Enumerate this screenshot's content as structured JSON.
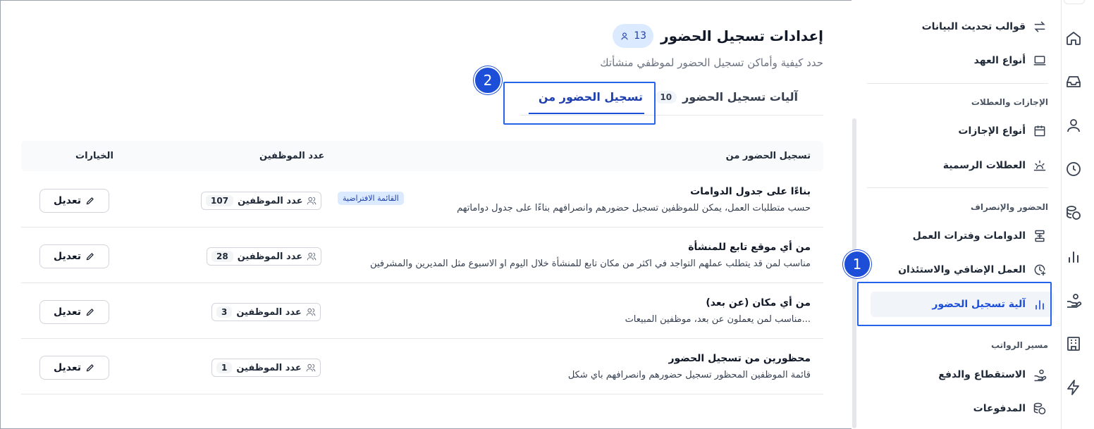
{
  "rail": {
    "icons": [
      "home-icon",
      "inbox-icon",
      "user-icon",
      "clock-icon",
      "coins-icon",
      "bar-chart-icon",
      "hand-money-icon",
      "building-icon",
      "lightning-icon"
    ]
  },
  "sidebar": {
    "items_top": [
      {
        "label": "قوالب تحديث البيانات",
        "icon": "swap-arrows-icon"
      },
      {
        "label": "أنواع العهد",
        "icon": "laptop-icon"
      }
    ],
    "section_leaves": "الإجازات والعطلات",
    "items_leaves": [
      {
        "label": "أنواع الإجازات",
        "icon": "calendar-icon"
      },
      {
        "label": "العطلات الرسمية",
        "icon": "sunset-icon"
      }
    ],
    "section_attendance": "الحضور والإنصراف",
    "items_attendance": [
      {
        "label": "الدوامات وفترات العمل",
        "icon": "shifts-icon"
      },
      {
        "label": "العمل الإضافي والاستئذان",
        "icon": "clock-plus-icon"
      },
      {
        "label": "آلية تسجيل الحضور",
        "icon": "bar-chart-icon"
      }
    ],
    "section_payroll": "مسير الرواتب",
    "items_payroll": [
      {
        "label": "الاستقطاع والدفع",
        "icon": "hand-money-icon"
      },
      {
        "label": "المدفوعات",
        "icon": "coins-icon"
      }
    ]
  },
  "annotations": {
    "one": "1",
    "two": "2"
  },
  "header": {
    "title": "إعدادات تسجيل الحضور",
    "count": "13",
    "subtitle": "حدد كيفية وأماكن تسجيل الحضور لموظفي منشأتك"
  },
  "tabs": {
    "mechanisms_label": "آليات تسجيل الحضور",
    "mechanisms_count": "10",
    "from_label": "تسجيل الحضور من"
  },
  "table": {
    "headers": {
      "source": "تسجيل الحضور من",
      "employees": "عدد الموظفين",
      "options": "الخيارات"
    },
    "emp_label": "عدد الموظفين",
    "edit_label": "تعديل",
    "default_tag": "القائمة الافتراضية",
    "rows": [
      {
        "title": "بناءًا على جدول الدوامات",
        "desc": "حسب متطلبات العمل، يمكن للموظفين تسجيل حضورهم وانصرافهم بناءًا على جدول دواماتهم",
        "count": "107"
      },
      {
        "title": "من أي موقع تابع للمنشأة",
        "desc": "مناسب لمن قد يتطلب عملهم التواجد في اكثر من مكان تابع للمنشأة خلال اليوم او الاسبوع مثل المديرين والمشرفين",
        "count": "28"
      },
      {
        "title": "من أي مكان (عن بعد)",
        "desc": "مناسب لمن يعملون عن بعد، موظفين المبيعات...",
        "count": "3"
      },
      {
        "title": "محظورين من تسجيل الحضور",
        "desc": "قائمة الموظفين المحظور تسجيل حضورهم وانصرافهم باي شكل",
        "count": "1"
      }
    ]
  },
  "colors": {
    "accent": "#1d4ed8",
    "highlight": "#2563eb",
    "pill": "#dbeafe"
  }
}
